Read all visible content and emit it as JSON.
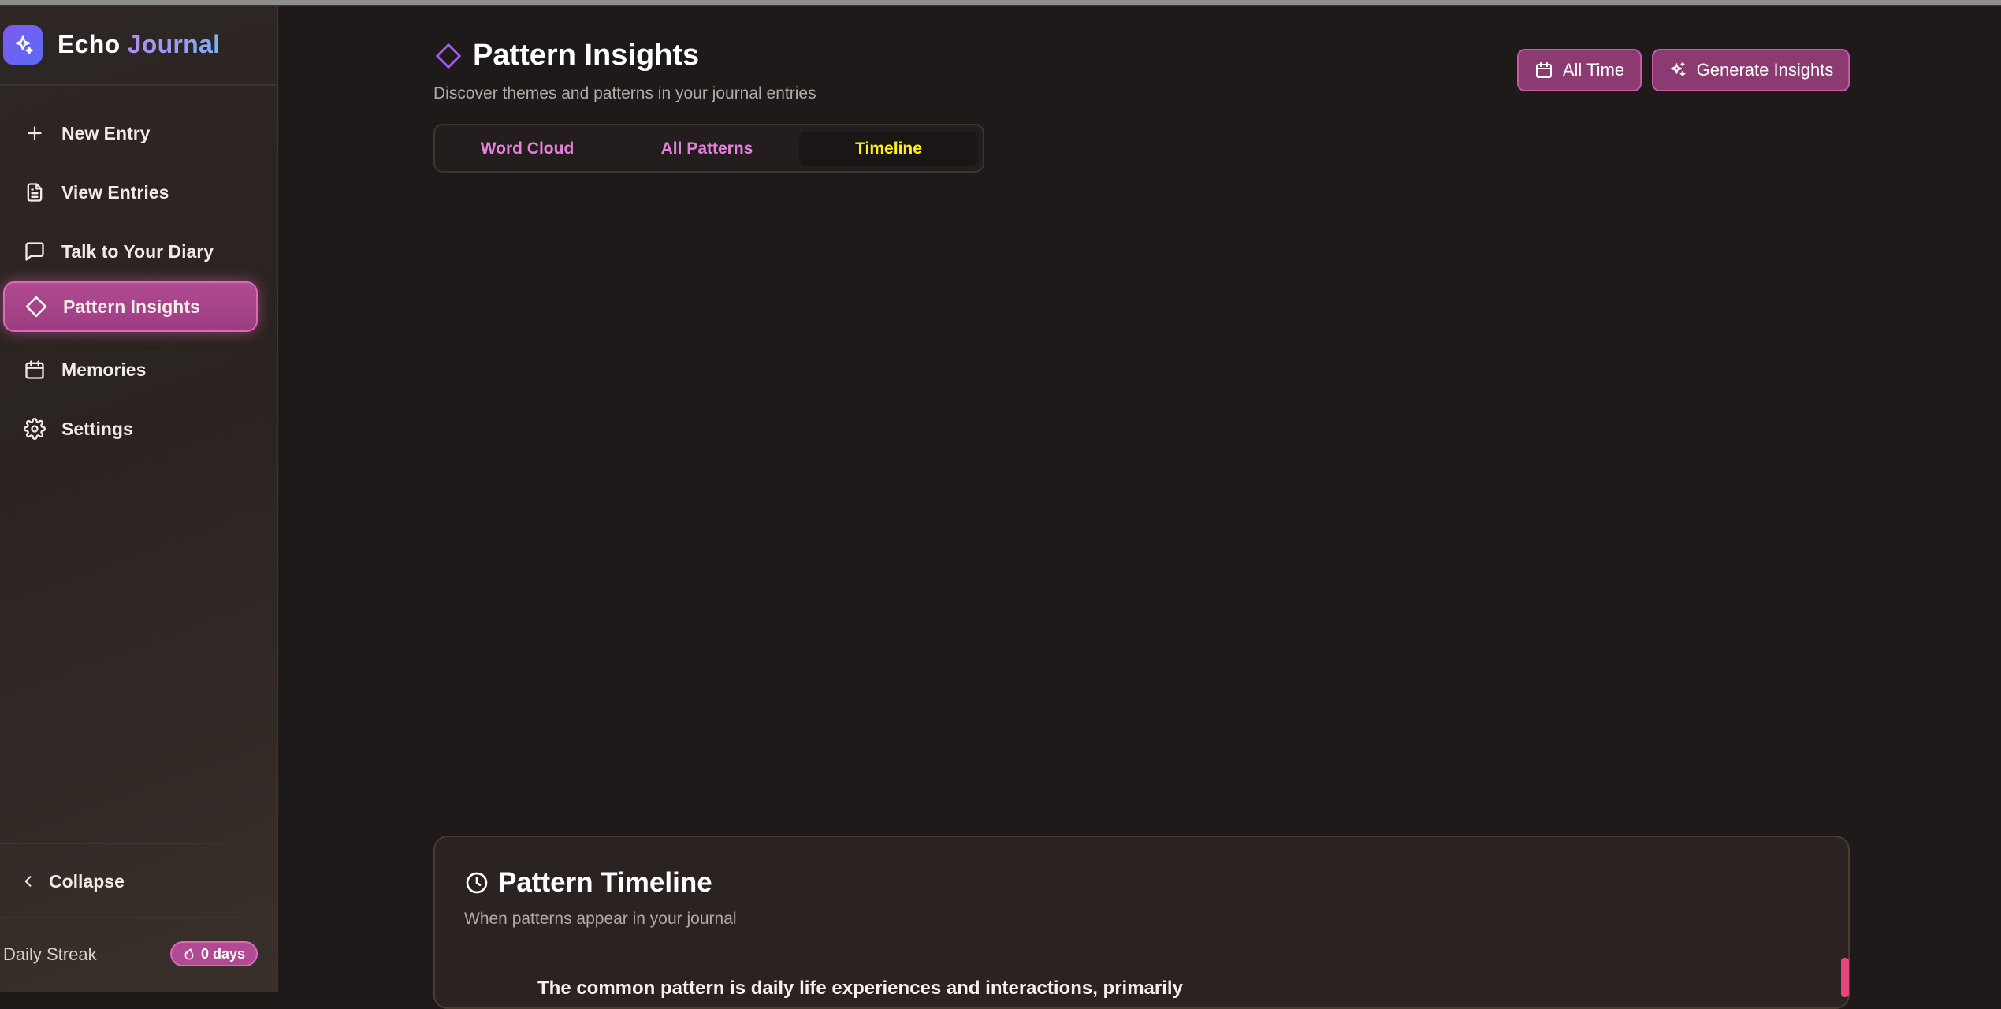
{
  "app": {
    "name_first": "Echo",
    "name_second": "Journal"
  },
  "sidebar": {
    "items": [
      {
        "label": "New Entry",
        "icon": "plus-icon"
      },
      {
        "label": "View Entries",
        "icon": "document-icon"
      },
      {
        "label": "Talk to Your Diary",
        "icon": "chat-bubble-icon"
      },
      {
        "label": "Pattern Insights",
        "icon": "diamond-icon",
        "active": true
      },
      {
        "label": "Memories",
        "icon": "calendar-icon"
      },
      {
        "label": "Settings",
        "icon": "gear-icon"
      }
    ],
    "collapse_label": "Collapse",
    "streak_label": "Daily Streak",
    "streak_value": "0 days"
  },
  "header": {
    "title": "Pattern Insights",
    "subtitle": "Discover themes and patterns in your journal entries",
    "time_filter_label": "All Time",
    "generate_label": "Generate Insights"
  },
  "tabs": [
    {
      "label": "Word Cloud"
    },
    {
      "label": "All Patterns"
    },
    {
      "label": "Timeline",
      "active": true
    }
  ],
  "timeline_card": {
    "title": "Pattern Timeline",
    "subtitle": "When patterns appear in your journal",
    "first_entry_text": "The common pattern is daily life experiences and interactions, primarily"
  },
  "colors": {
    "accent_pink": "#b04a92",
    "tab_text_pink": "#e77fde",
    "active_tab_yellow": "#fff01c",
    "logo_purple": "#7d5bf0",
    "background": "#1e1a1a",
    "timeline_marker": "#e2487a"
  }
}
